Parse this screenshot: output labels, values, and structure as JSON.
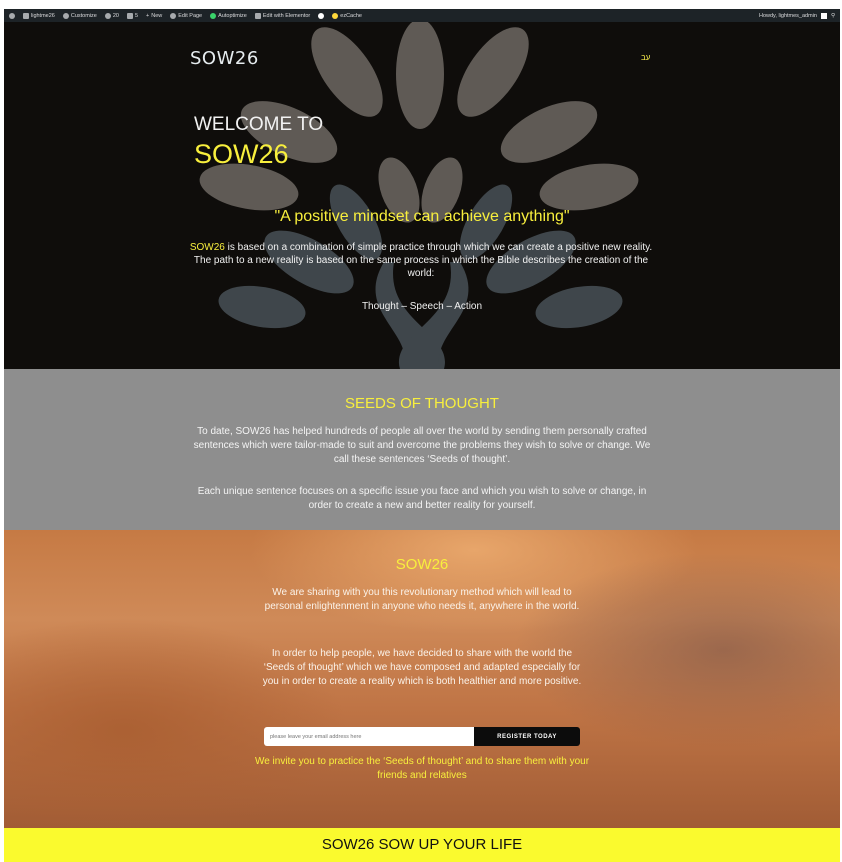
{
  "admin_bar": {
    "site": "lightme26",
    "customize": "Customize",
    "updates": "20",
    "comments": "5",
    "new": "New",
    "edit_page": "Edit Page",
    "autoptimize": "Autoptimize",
    "elementor": "Edit with Elementor",
    "ezcache": "ezCache",
    "howdy": "Howdy, lightmes_admin"
  },
  "header": {
    "logo": "SOW26",
    "language": "עב"
  },
  "hero": {
    "welcome": "WELCOME TO",
    "brand": "SOW26",
    "quote": "\"A positive mindset can achieve anything\"",
    "intro_brand": "SOW26",
    "intro_text": " is based on a combination of simple practice through which we can create a positive new reality.  The path to a new reality is based on the same process in which the Bible describes the  creation of the world:",
    "tsa": "Thought – Speech – Action"
  },
  "seeds": {
    "title": "SEEDS OF THOUGHT",
    "p1": "To date, SOW26 has helped hundreds of people all over the world by sending them personally crafted sentences which were tailor-made to suit and overcome the problems they wish to solve or change. We call these sentences ‘Seeds of thought’.",
    "p2": "Each unique sentence focuses on a specific issue you face and which you wish to solve or change, in order to create a new and better reality for yourself."
  },
  "sow": {
    "title": "SOW26",
    "p1": "We are sharing with you this revolutionary method which will lead to personal enlightenment in anyone who needs it, anywhere in the world.",
    "p2": "In order to help people, we have decided to share with the world the ‘Seeds of thought’ which we have composed and adapted especially for you in order to create a reality which is both healthier and more positive.",
    "email_placeholder": "please leave your email address here",
    "register_label": "REGISTER TODAY",
    "invite": "We invite you to practice the ‘Seeds of thought’ and to share them with your friends and relatives"
  },
  "footer": {
    "text": "SOW26 SOW UP YOUR LIFE"
  },
  "colors": {
    "accent": "#f8ef3d",
    "admin_bar": "#1d2327",
    "seeds_bg": "#8e8e8e",
    "footer_bg": "#fafa2e"
  }
}
